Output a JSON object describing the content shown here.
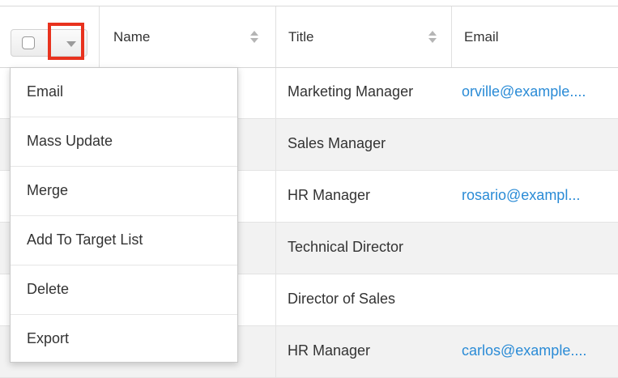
{
  "table": {
    "columns": [
      {
        "label": "Name"
      },
      {
        "label": "Title"
      },
      {
        "label": "Email"
      }
    ],
    "rows": [
      {
        "title": "Marketing Manager",
        "email": "orville@example...."
      },
      {
        "title": "Sales Manager",
        "email": ""
      },
      {
        "title": "HR Manager",
        "email": "rosario@exampl..."
      },
      {
        "title": "Technical Director",
        "email": ""
      },
      {
        "title": "Director of Sales",
        "email": ""
      },
      {
        "title": "HR Manager",
        "email": "carlos@example...."
      }
    ]
  },
  "menu": {
    "items": [
      {
        "label": "Email"
      },
      {
        "label": "Mass Update"
      },
      {
        "label": "Merge"
      },
      {
        "label": "Add To Target List"
      },
      {
        "label": "Delete"
      },
      {
        "label": "Export"
      }
    ]
  },
  "colors": {
    "link": "#2a8bd6",
    "highlight": "#e8321e"
  }
}
